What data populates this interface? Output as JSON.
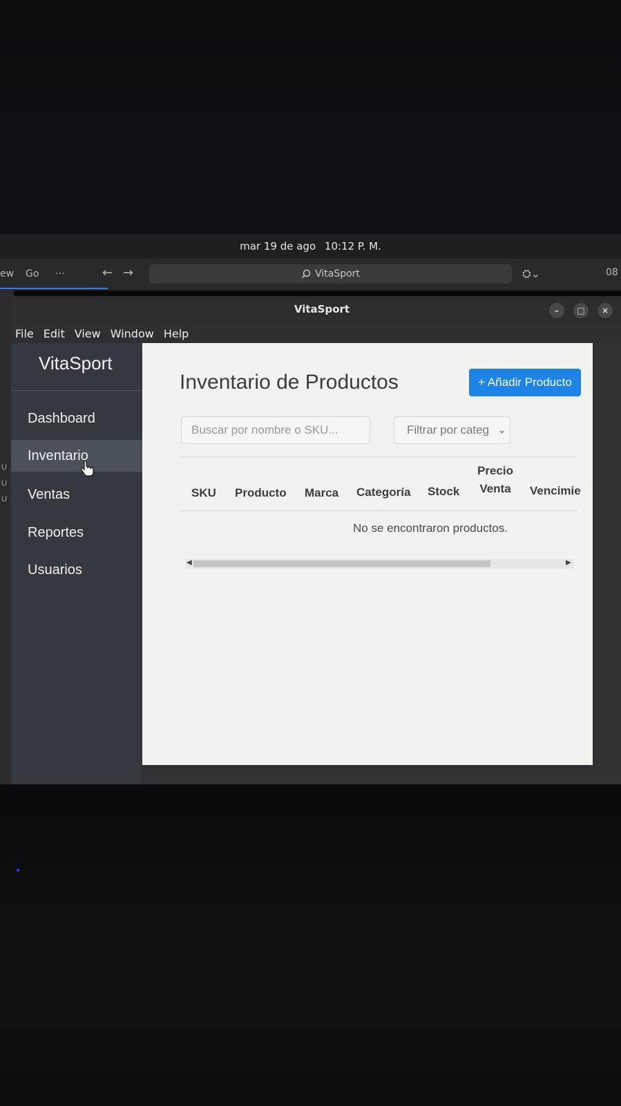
{
  "os_bar": {
    "clock": {
      "date": "mar 19 de ago",
      "time": "10:12 P. M."
    }
  },
  "background_browser": {
    "tab_partial": "ew",
    "tab_go": "Go",
    "tab_more": "···",
    "back": "←",
    "forward": "→",
    "url_text": "VitaSport",
    "copilot": "⛭⌄",
    "extra": "08"
  },
  "window": {
    "title": "VitaSport",
    "controls": {
      "minimize": "–",
      "maximize": "□",
      "close": "×"
    }
  },
  "menu": {
    "items": [
      {
        "label": "File"
      },
      {
        "label": "Edit"
      },
      {
        "label": "View"
      },
      {
        "label": "Window"
      },
      {
        "label": "Help"
      }
    ]
  },
  "sidebar": {
    "brand": "VitaSport",
    "items": [
      {
        "label": "Dashboard",
        "active": false
      },
      {
        "label": "Inventario",
        "active": true
      },
      {
        "label": "Ventas",
        "active": false
      },
      {
        "label": "Reportes",
        "active": false
      },
      {
        "label": "Usuarios",
        "active": false
      }
    ]
  },
  "main": {
    "title": "Inventario de Productos",
    "add_button": "+ Añadir Producto",
    "search_placeholder": "Buscar por nombre o SKU...",
    "filter_value": "Filtrar por categ",
    "table": {
      "headers": {
        "sku": "SKU",
        "producto": "Producto",
        "marca": "Marca",
        "categoria": "Categoría",
        "stock": "Stock",
        "precio_1": "Precio",
        "precio_2": "Venta",
        "vencimiento": "Vencimie"
      },
      "empty_message": "No se encontraron productos."
    }
  },
  "colors": {
    "accent": "#1e83e6",
    "sidebar_bg": "#34393f",
    "sidebar_active": "#4b5158",
    "content_bg": "#f2f2ef"
  }
}
